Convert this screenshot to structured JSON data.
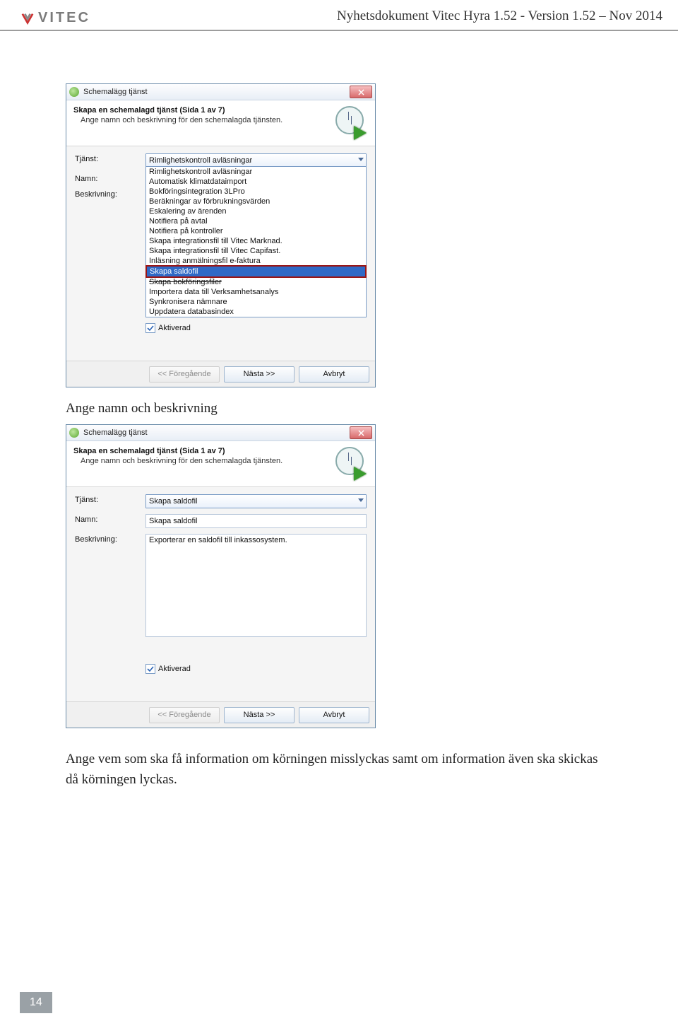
{
  "header": {
    "brand": "VITEC",
    "title": "Nyhetsdokument Vitec Hyra 1.52 - Version 1.52 – Nov 2014"
  },
  "page_number": "14",
  "caption1": "Ange namn och beskrivning",
  "caption2": "Ange vem som ska få information om körningen misslyckas samt om information även ska skickas då körningen lyckas.",
  "dialog1": {
    "window_title": "Schemalägg tjänst",
    "heading": "Skapa en schemalagd tjänst (Sida 1 av 7)",
    "subheading": "Ange namn och beskrivning för den schemalagda tjänsten.",
    "labels": {
      "tjanst": "Tjänst:",
      "namn": "Namn:",
      "beskrivning": "Beskrivning:"
    },
    "combo_selected": "Rimlighetskontroll avläsningar",
    "dropdown_items": [
      "Rimlighetskontroll avläsningar",
      "Automatisk klimatdataimport",
      "Bokföringsintegration 3LPro",
      "Beräkningar av förbrukningsvärden",
      "Eskalering av ärenden",
      "Notifiera på avtal",
      "Notifiera på kontroller",
      "Skapa integrationsfil till Vitec Marknad.",
      "Skapa integrationsfil till Vitec Capifast.",
      "Inläsning anmälningsfil e-faktura",
      "Skapa saldofil",
      "Skapa bokföringsfiler",
      "Importera data till Verksamhetsanalys",
      "Synkronisera nämnare",
      "Uppdatera databasindex"
    ],
    "activated_label": "Aktiverad",
    "buttons": {
      "prev": "<< Föregående",
      "next": "Nästa >>",
      "cancel": "Avbryt"
    }
  },
  "dialog2": {
    "window_title": "Schemalägg tjänst",
    "heading": "Skapa en schemalagd tjänst (Sida 1 av 7)",
    "subheading": "Ange namn och beskrivning för den schemalagda tjänsten.",
    "labels": {
      "tjanst": "Tjänst:",
      "namn": "Namn:",
      "beskrivning": "Beskrivning:"
    },
    "combo_value": "Skapa saldofil",
    "name_value": "Skapa saldofil",
    "desc_value": "Exporterar en saldofil till inkassosystem.",
    "activated_label": "Aktiverad",
    "buttons": {
      "prev": "<< Föregående",
      "next": "Nästa >>",
      "cancel": "Avbryt"
    }
  }
}
